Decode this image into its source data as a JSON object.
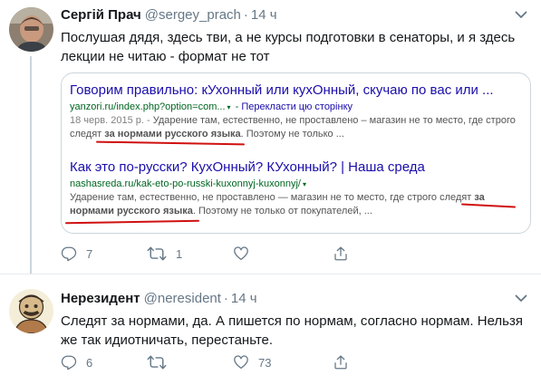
{
  "tweets": [
    {
      "author": {
        "name": "Сергій Прач",
        "handle": "@sergey_prach",
        "time": "14 ч",
        "dot": "·"
      },
      "text": "Послушая дядя, здесь тви, а не курсы подготовки в сенаторы, и я здесь лекции не читаю - формат не тот",
      "media": {
        "results": [
          {
            "title": "Говорим правильно: кУхонный или кухОнный, скучаю по вас или ...",
            "url": "yanzori.ru/index.php?option=com...",
            "translate": "Перекласти цю сторінку",
            "date": "18 черв. 2015 р.",
            "date_sep": " - ",
            "snippet_before": "Ударение там, естественно, не проставлено – магазин не то место, где строго следят ",
            "snippet_bold": "за нормами русского языка",
            "snippet_after": ". Поэтому не только ..."
          },
          {
            "title": "Как это по-русски? КухОнный? КУхонный? | Наша среда",
            "url": "nashasreda.ru/kak-eto-po-russki-kuxonnyj-kuxonnyj/",
            "translate": "",
            "date": "",
            "date_sep": "",
            "snippet_before": "Ударение там, естественно, не проставлено — магазин не то место, где строго следят ",
            "snippet_bold": "за нормами русского языка",
            "snippet_after": ". Поэтому не только от покупателей, ..."
          }
        ],
        "url_marker": "▾",
        "url_sep": " - "
      },
      "stats": {
        "replies": "7",
        "retweets": "1",
        "likes": ""
      }
    },
    {
      "author": {
        "name": "Нерезидент",
        "handle": "@neresident",
        "time": "14 ч",
        "dot": "·"
      },
      "text": "Следят за нормами, да. А пишется по нормам, согласно нормам. Нельзя же так идиотничать, перестаньте.",
      "stats": {
        "replies": "6",
        "retweets": "",
        "likes": "73"
      }
    }
  ],
  "icons": [
    "avatar",
    "chevron-down-icon",
    "reply-icon",
    "retweet-icon",
    "like-icon",
    "share-icon"
  ],
  "colors": {
    "text": "#14171a",
    "secondary": "#657786",
    "border": "#e6ecf0",
    "link_title": "#1a0dab",
    "url_green": "#006621",
    "underline_red": "#d01010"
  }
}
